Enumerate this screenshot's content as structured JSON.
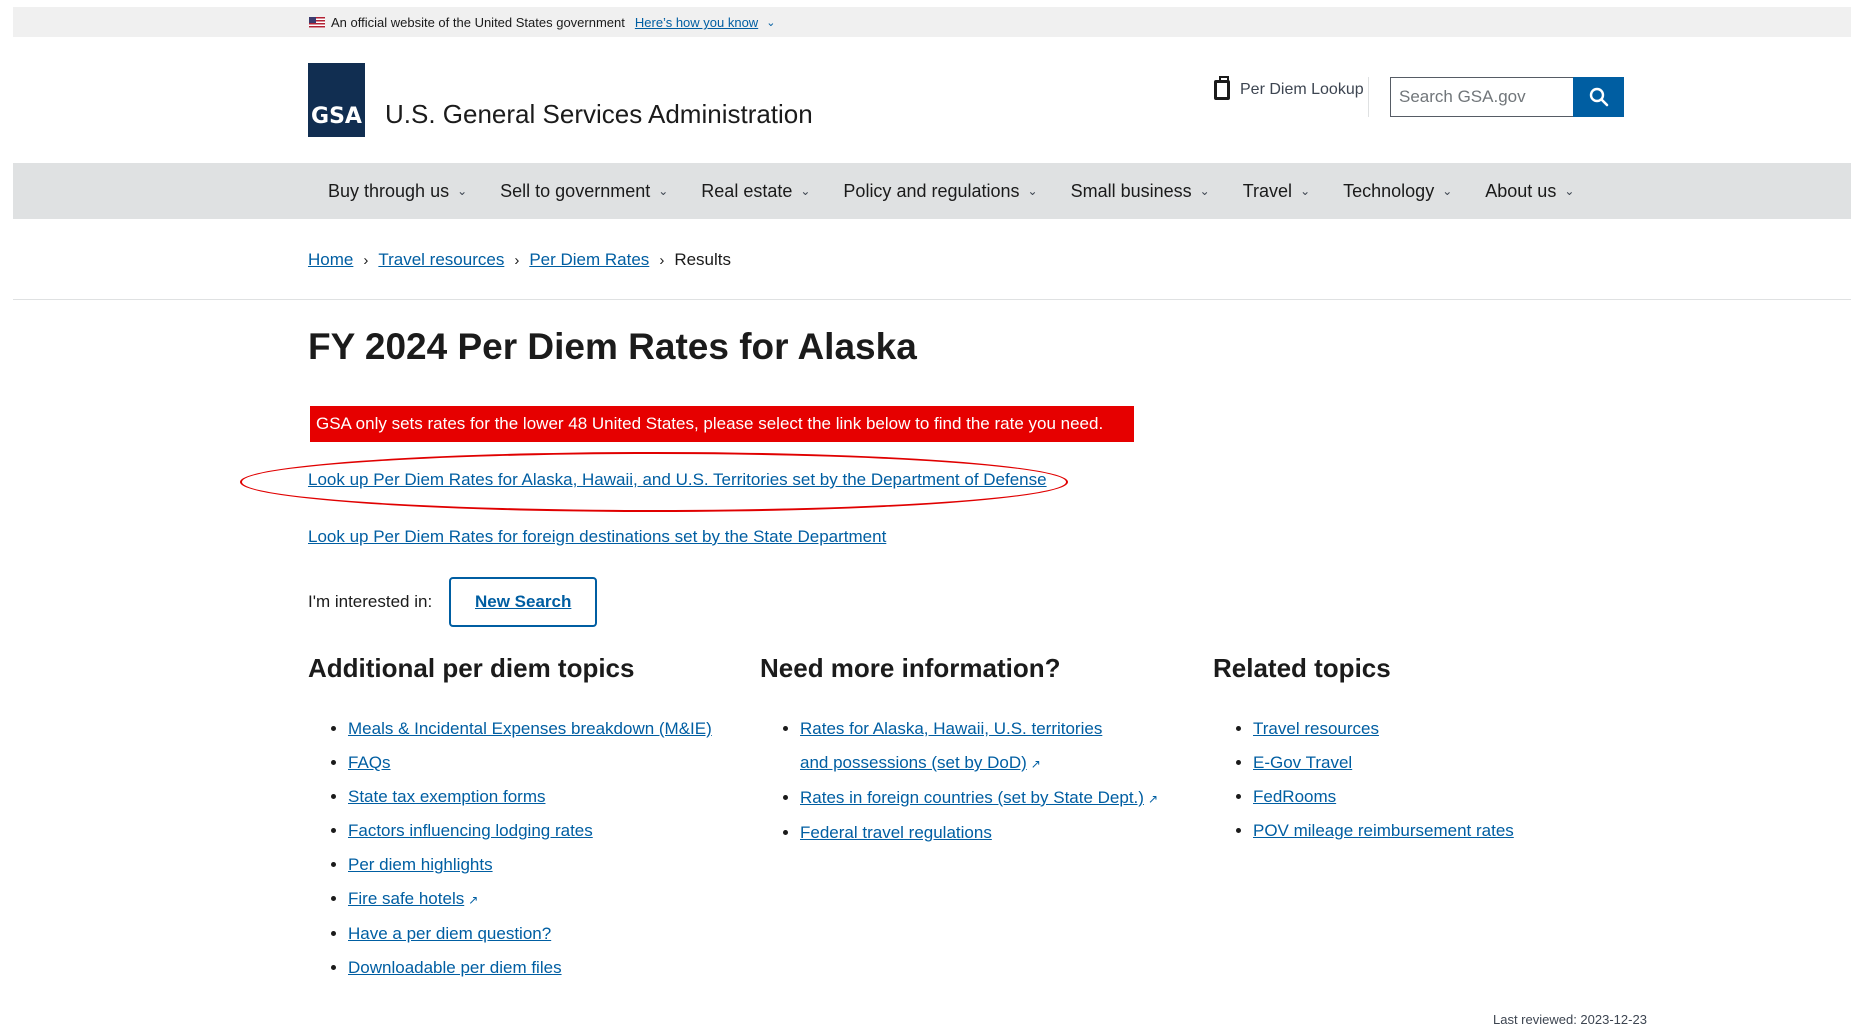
{
  "banner": {
    "text": "An official website of the United States government",
    "link": "Here’s how you know"
  },
  "header": {
    "logo_text": "GSA",
    "site_name": "U.S. General Services Administration",
    "per_diem_lookup": "Per Diem Lookup",
    "search_placeholder": "Search GSA.gov"
  },
  "nav": {
    "items": [
      {
        "label": "Buy through us"
      },
      {
        "label": "Sell to government"
      },
      {
        "label": "Real estate"
      },
      {
        "label": "Policy and regulations"
      },
      {
        "label": "Small business"
      },
      {
        "label": "Travel"
      },
      {
        "label": "Technology"
      },
      {
        "label": "About us"
      }
    ]
  },
  "breadcrumb": {
    "home": "Home",
    "travel": "Travel resources",
    "perdiem": "Per Diem Rates",
    "current": "Results"
  },
  "main": {
    "title": "FY 2024 Per Diem Rates for Alaska",
    "alert": "GSA only sets rates for the lower 48 United States, please select the link below to find the rate you need.",
    "link_dod": "Look up Per Diem Rates for Alaska, Hawaii, and U.S. Territories set by the Department of Defense",
    "link_state": "Look up Per Diem Rates for foreign destinations set by the State Department",
    "interest_label": "I'm interested in:",
    "new_search": "New Search"
  },
  "columns": {
    "additional": {
      "title": "Additional per diem topics",
      "items": [
        "Meals & Incidental Expenses breakdown (M&IE)",
        "FAQs",
        "State tax exemption forms",
        "Factors influencing lodging rates",
        "Per diem highlights",
        "Fire safe hotels",
        "Have a per diem question?",
        "Downloadable per diem files"
      ]
    },
    "more_info": {
      "title": "Need more information?",
      "items": [
        "Rates for Alaska, Hawaii, U.S. territories and possessions (set by DoD)",
        "Rates in foreign countries (set by State Dept.)",
        "Federal travel regulations"
      ]
    },
    "related": {
      "title": "Related topics",
      "items": [
        "Travel resources",
        "E-Gov Travel",
        "FedRooms",
        "POV mileage reimbursement rates"
      ]
    }
  },
  "footer": {
    "last_reviewed": "Last reviewed: 2023-12-23"
  }
}
